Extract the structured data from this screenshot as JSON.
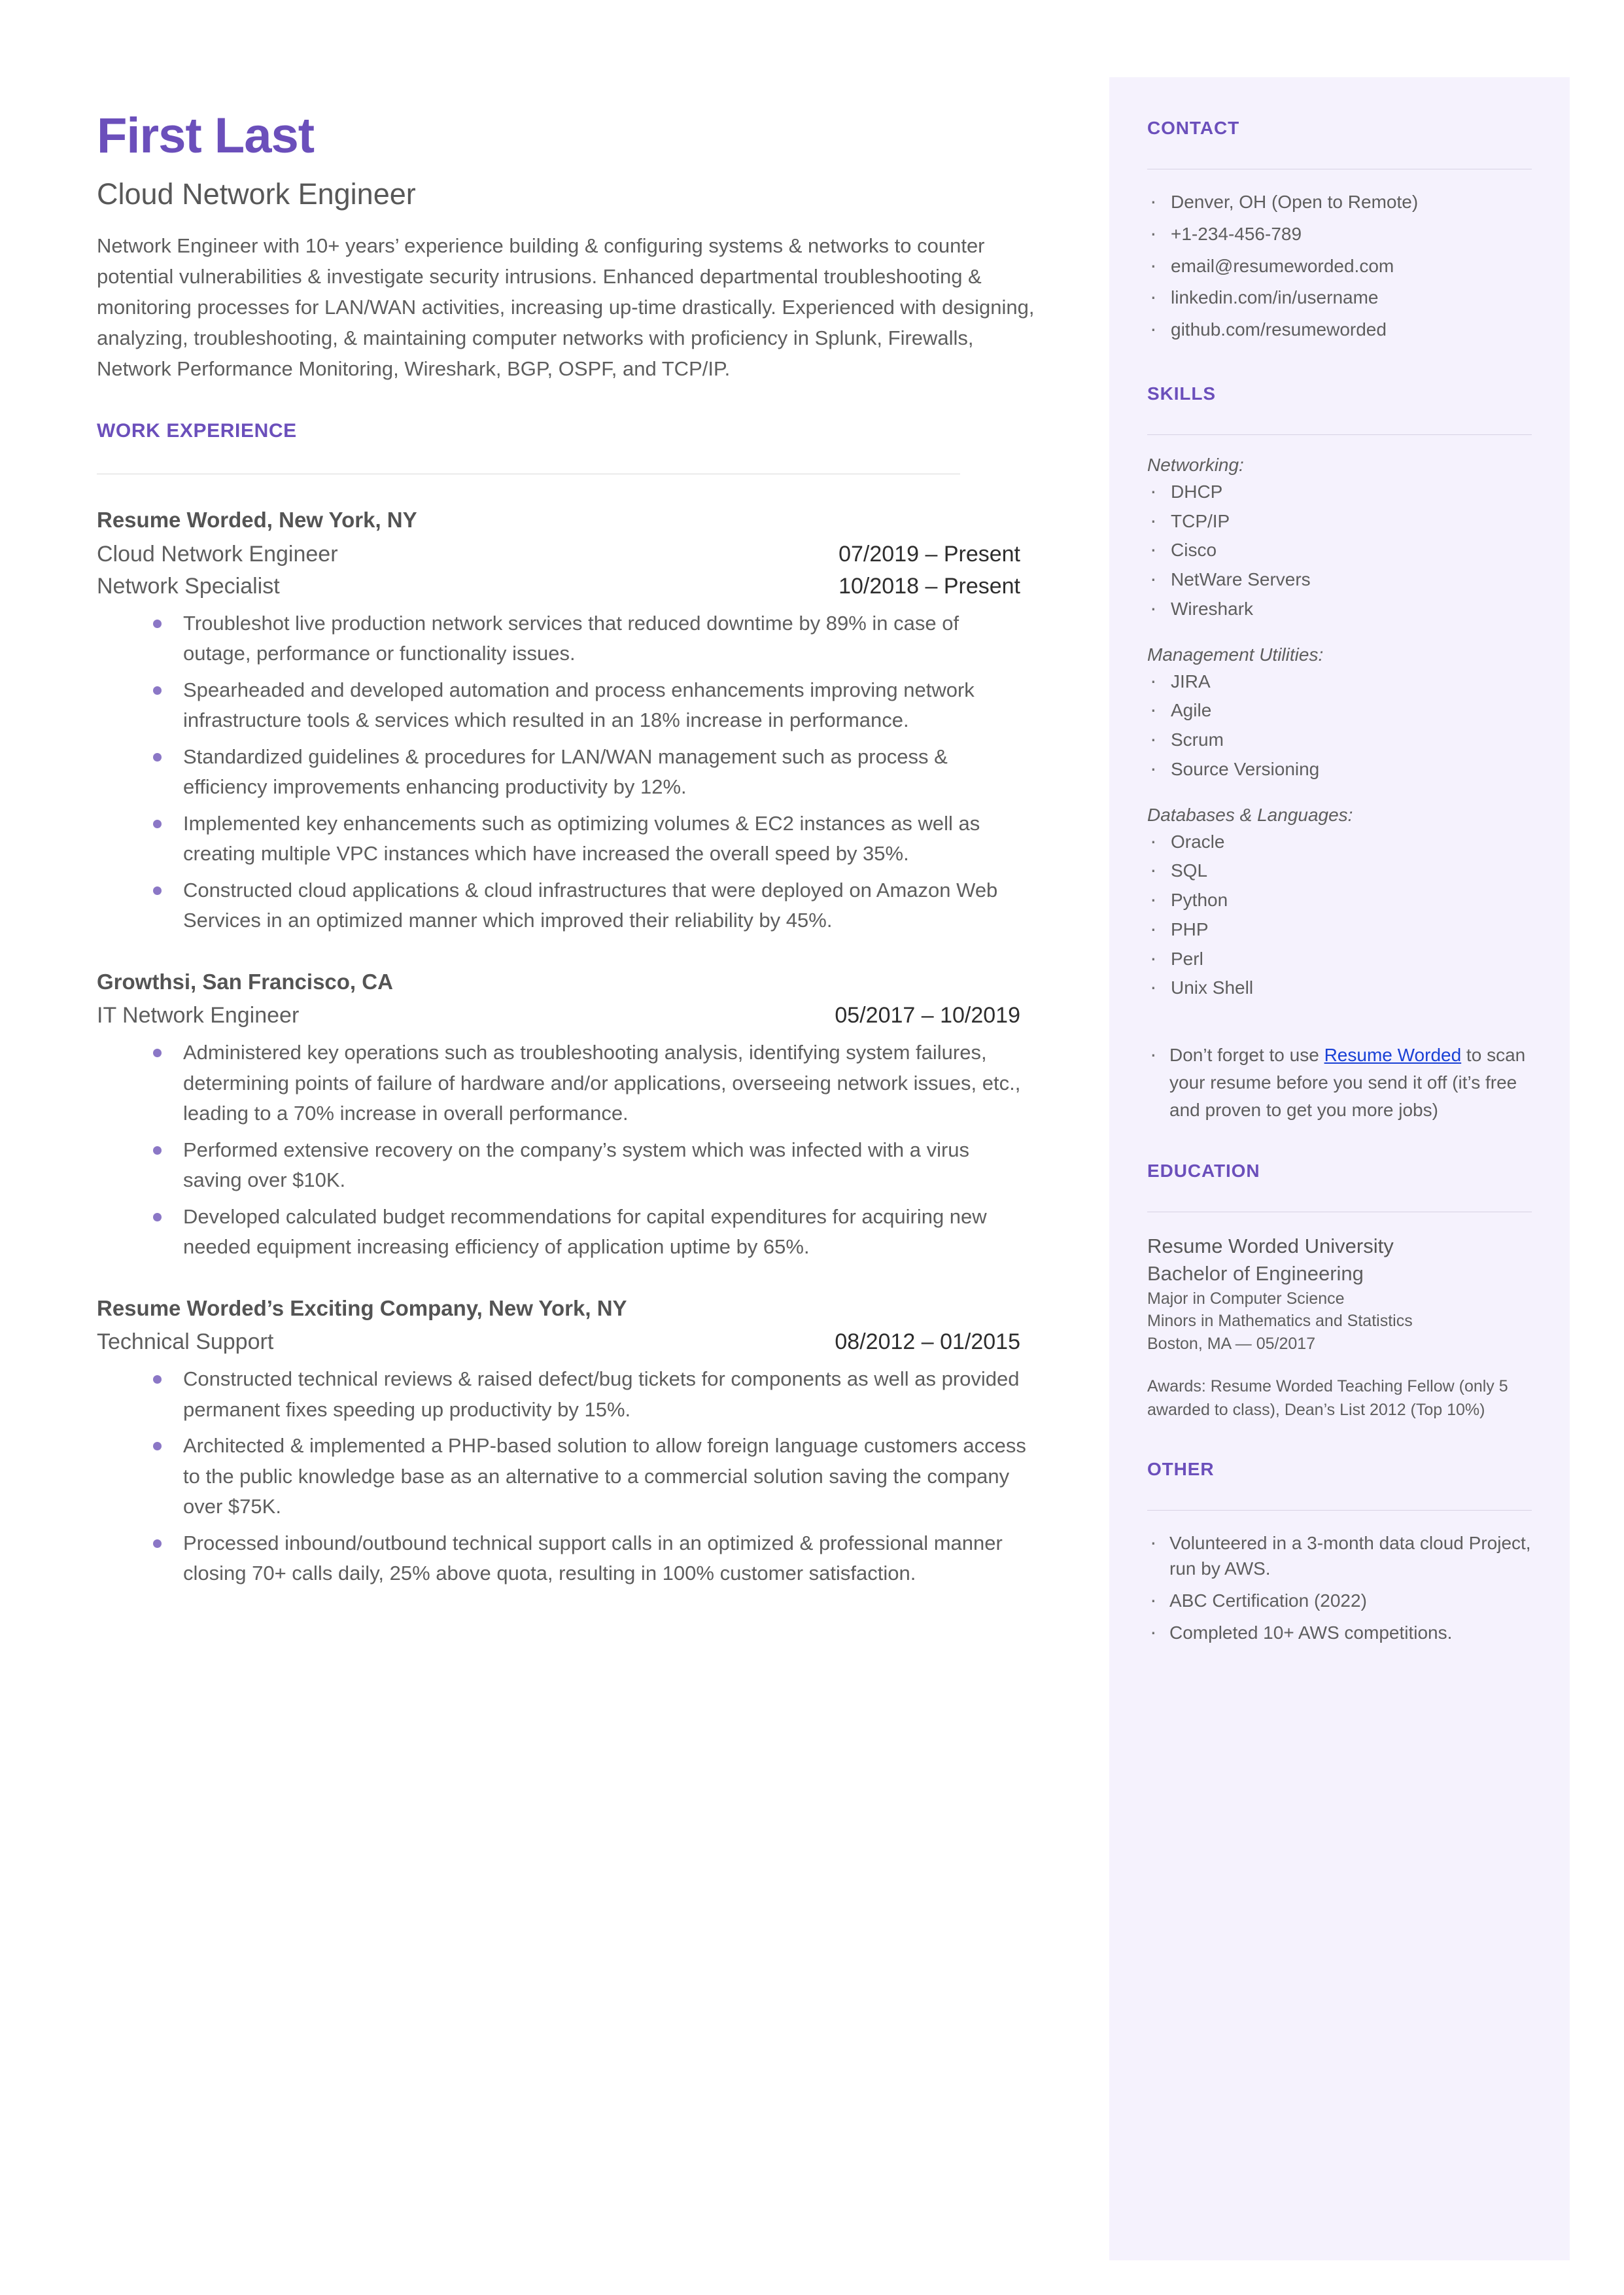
{
  "colors": {
    "accent_purple": "#6b4fbb",
    "bullet_purple": "#8b77c6",
    "sidebar_bg": "#f5f2fd",
    "link_blue": "#1a41d6",
    "body_text": "#5e5e5e"
  },
  "header": {
    "name": "First Last",
    "headline": "Cloud Network Engineer",
    "summary": "Network Engineer with 10+ years’ experience building & configuring systems & networks to counter potential vulnerabilities & investigate security intrusions. Enhanced departmental troubleshooting & monitoring processes for LAN/WAN activities, increasing up-time drastically. Experienced with designing, analyzing, troubleshooting, & maintaining computer networks with proficiency in Splunk, Firewalls, Network Performance Monitoring, Wireshark, BGP, OSPF, and TCP/IP."
  },
  "work_experience": {
    "heading": "WORK EXPERIENCE",
    "jobs": [
      {
        "company": "Resume Worded, New York, NY",
        "roles": [
          {
            "title": "Cloud Network Engineer",
            "dates": "07/2019 – Present"
          },
          {
            "title": "Network Specialist",
            "dates": "10/2018 – Present"
          }
        ],
        "bullets": [
          "Troubleshot live production network services that reduced downtime by 89% in case of outage, performance or functionality issues.",
          "Spearheaded and developed automation and process enhancements improving network infrastructure tools & services which resulted in an 18% increase in performance.",
          "Standardized guidelines & procedures for LAN/WAN management such as process & efficiency improvements enhancing productivity by 12%.",
          "Implemented key enhancements such as optimizing volumes & EC2 instances as well as creating multiple VPC instances which have increased the overall speed by 35%.",
          "Constructed cloud applications & cloud infrastructures that were deployed on Amazon Web Services in an optimized manner which improved their reliability by 45%."
        ]
      },
      {
        "company": "Growthsi, San Francisco, CA",
        "roles": [
          {
            "title": "IT Network Engineer",
            "dates": "05/2017 – 10/2019"
          }
        ],
        "bullets": [
          "Administered key operations such as troubleshooting analysis, identifying system failures, determining points of failure of hardware and/or applications, overseeing network issues, etc., leading to a 70% increase in overall performance.",
          "Performed extensive recovery on the company’s system which was infected with a virus saving over $10K.",
          "Developed calculated budget recommendations for capital expenditures for acquiring new needed equipment increasing efficiency of application uptime by 65%."
        ]
      },
      {
        "company": "Resume Worded’s Exciting Company, New York, NY",
        "roles": [
          {
            "title": "Technical Support",
            "dates": "08/2012 – 01/2015"
          }
        ],
        "bullets": [
          "Constructed technical reviews & raised defect/bug tickets for components as well as provided permanent fixes speeding up productivity by 15%.",
          "Architected & implemented a PHP-based solution to allow foreign language customers access to the public knowledge base as an alternative to a commercial solution saving the company over $75K.",
          "Processed inbound/outbound technical support calls in an optimized & professional manner closing 70+ calls daily, 25% above quota, resulting in 100% customer satisfaction."
        ]
      }
    ]
  },
  "contact": {
    "heading": "CONTACT",
    "items": [
      "Denver, OH (Open to Remote)",
      "+1-234-456-789",
      "email@resumeworded.com",
      "linkedin.com/in/username",
      "github.com/resumeworded"
    ]
  },
  "skills": {
    "heading": "SKILLS",
    "groups": [
      {
        "label": "Networking:",
        "items": [
          "DHCP",
          "TCP/IP",
          "Cisco",
          "NetWare Servers",
          "Wireshark"
        ]
      },
      {
        "label": "Management Utilities:",
        "items": [
          "JIRA",
          "Agile",
          "Scrum",
          "Source Versioning"
        ]
      },
      {
        "label": "Databases & Languages:",
        "items": [
          "Oracle",
          "SQL",
          "Python",
          "PHP",
          "Perl",
          "Unix Shell"
        ]
      }
    ],
    "promo": {
      "before": "Don’t forget to use ",
      "link": "Resume Worded",
      "after": " to scan your resume before you send it off (it’s free and proven to get you more jobs)"
    }
  },
  "education": {
    "heading": "EDUCATION",
    "school": "Resume Worded University",
    "degree": "Bachelor of Engineering",
    "major": "Major in Computer Science",
    "minors": "Minors in Mathematics and Statistics",
    "location_date": "Boston, MA — 05/2017",
    "awards": "Awards: Resume Worded Teaching Fellow (only 5 awarded to class), Dean’s List 2012 (Top 10%)"
  },
  "other": {
    "heading": "OTHER",
    "items": [
      "Volunteered in a 3-month data cloud Project, run by AWS.",
      "ABC Certification (2022)",
      "Completed 10+ AWS competitions."
    ]
  }
}
